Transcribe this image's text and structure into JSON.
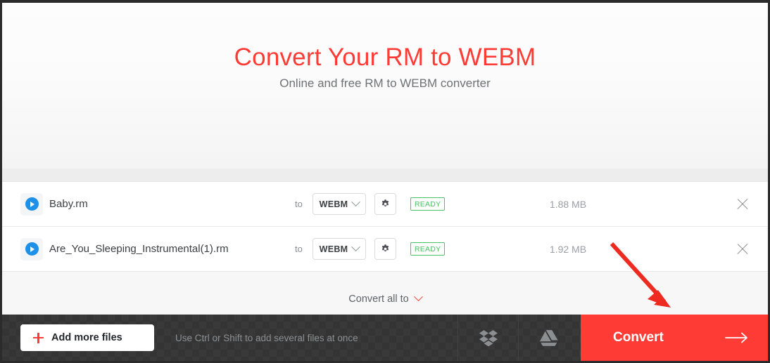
{
  "hero": {
    "title": "Convert Your RM to WEBM",
    "subtitle": "Online and free RM to WEBM converter",
    "title_color": "#ff3b36"
  },
  "file_list": {
    "to_label": "to",
    "rows": [
      {
        "icon": "play-icon",
        "name": "Baby.rm",
        "target_format": "WEBM",
        "settings_icon": "gear-icon",
        "status": "READY",
        "status_color": "#4cc266",
        "size": "1.88 MB",
        "remove_icon": "close-icon"
      },
      {
        "icon": "play-icon",
        "name": "Are_You_Sleeping_Instrumental(1).rm",
        "target_format": "WEBM",
        "settings_icon": "gear-icon",
        "status": "READY",
        "status_color": "#4cc266",
        "size": "1.92 MB",
        "remove_icon": "close-icon"
      }
    ]
  },
  "convert_all": {
    "label": "Convert all to",
    "chevron_icon": "chevron-down-icon"
  },
  "toolbar": {
    "add_more_label": "Add more files",
    "add_more_icon": "plus-icon",
    "hint": "Use Ctrl or Shift to add several files at once",
    "dropbox_icon": "dropbox-icon",
    "gdrive_icon": "google-drive-icon",
    "convert_label": "Convert",
    "convert_arrow_icon": "arrow-right-icon",
    "convert_color": "#ff3b36"
  },
  "annotation": {
    "type": "arrow",
    "color": "#ee2b20"
  }
}
